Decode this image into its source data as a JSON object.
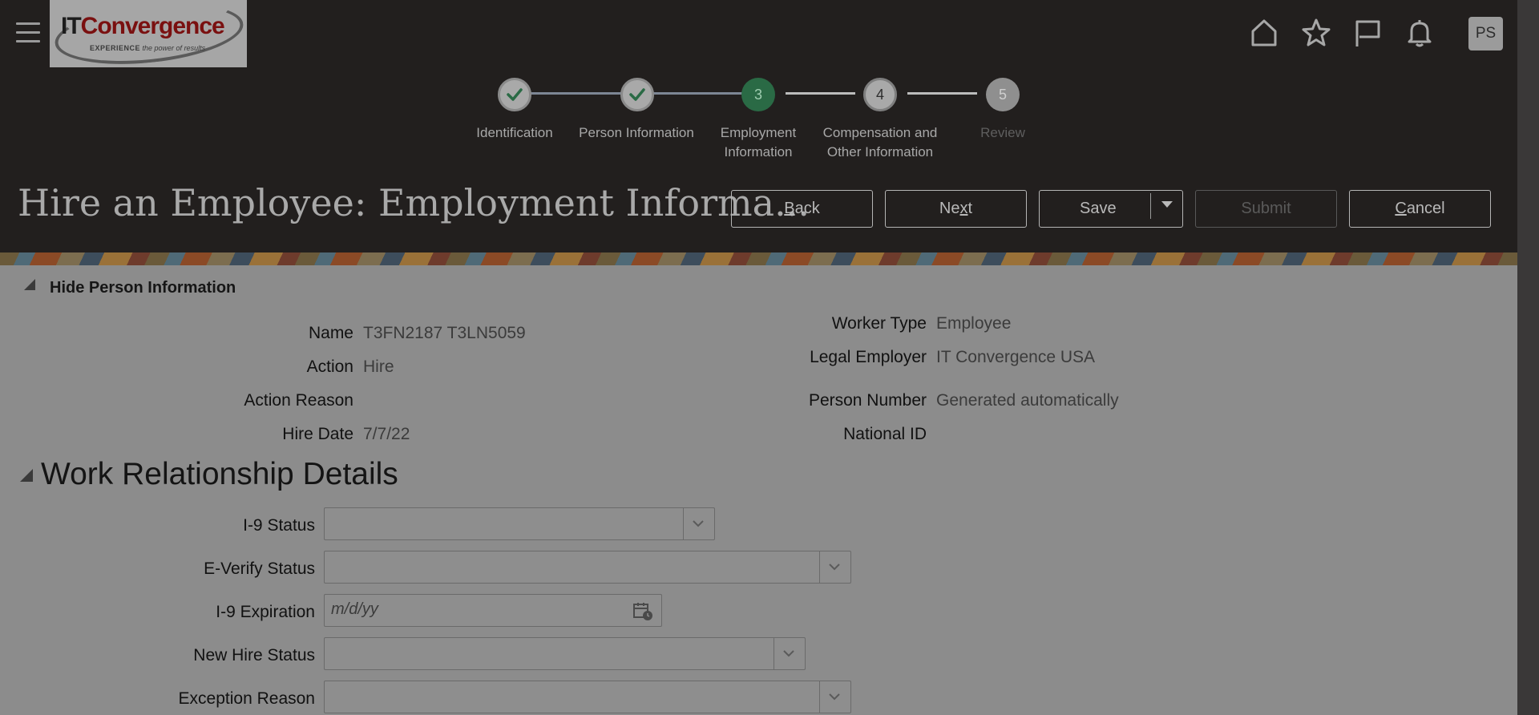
{
  "header": {
    "logo": {
      "name_part1": "IT",
      "name_part2": "Convergence",
      "tagline_bold": "EXPERIENCE",
      "tagline_rest": " the power of results"
    },
    "avatar_initials": "PS",
    "icons": [
      "menu-icon",
      "home-icon",
      "favorites-icon",
      "flag-icon",
      "bell-icon"
    ]
  },
  "train": {
    "steps": [
      {
        "number": "",
        "label": "Identification",
        "state": "done"
      },
      {
        "number": "",
        "label": "Person Information",
        "state": "done"
      },
      {
        "number": "3",
        "label_line1": "Employment",
        "label_line2": "Information",
        "state": "current"
      },
      {
        "number": "4",
        "label_line1": "Compensation and",
        "label_line2": "Other Information",
        "state": "future"
      },
      {
        "number": "5",
        "label": "Review",
        "state": "disabled"
      }
    ]
  },
  "page": {
    "title": "Hire an Employee: Employment Informa..."
  },
  "buttons": {
    "back_prefix": "",
    "back_access": "B",
    "back_rest": "ack",
    "next_prefix": "Ne",
    "next_access": "x",
    "next_rest": "t",
    "save": "Save",
    "submit": "Submit",
    "cancel_prefix": "",
    "cancel_access": "C",
    "cancel_rest": "ancel"
  },
  "person_info": {
    "toggle_label": "Hide Person Information",
    "left": [
      {
        "label": "Name",
        "value": "T3FN2187 T3LN5059"
      },
      {
        "label": "Action",
        "value": "Hire"
      },
      {
        "label": "Action Reason",
        "value": ""
      },
      {
        "label": "Hire Date",
        "value": "7/7/22"
      }
    ],
    "right": [
      {
        "label": "Worker Type",
        "value": "Employee"
      },
      {
        "label": "Legal Employer",
        "value": "IT Convergence USA"
      },
      {
        "label": "Person Number",
        "value": "Generated automatically"
      },
      {
        "label": "National ID",
        "value": ""
      }
    ]
  },
  "work_relationship": {
    "title": "Work Relationship Details",
    "fields": {
      "i9_status": {
        "label": "I-9 Status",
        "value": ""
      },
      "everify_status": {
        "label": "E-Verify Status",
        "value": ""
      },
      "i9_expiration": {
        "label": "I-9 Expiration",
        "placeholder": "m/d/yy"
      },
      "new_hire_status": {
        "label": "New Hire Status",
        "value": ""
      },
      "exception_reason": {
        "label": "Exception Reason",
        "value": ""
      }
    }
  },
  "colors": {
    "header_bg": "#221f1e",
    "content_bg": "#8c8c8c",
    "current_step": "#2a6a45"
  }
}
